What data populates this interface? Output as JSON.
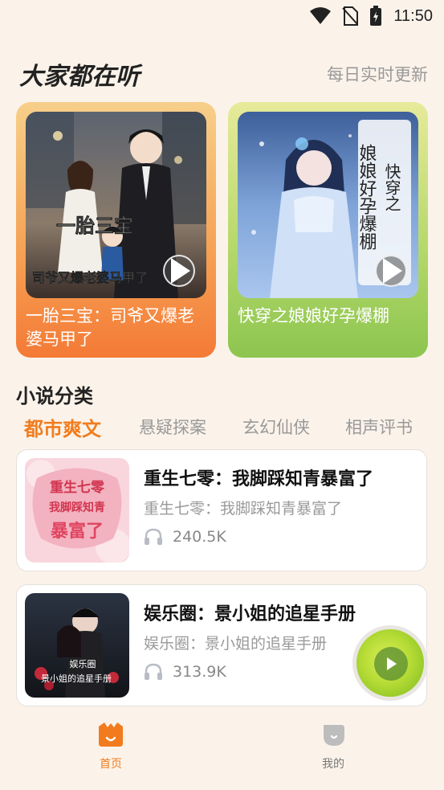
{
  "status_bar": {
    "time": "11:50"
  },
  "popular": {
    "title": "大家都在听",
    "subtitle": "每日实时更新",
    "cards": [
      {
        "title": "一胎三宝：司爷又爆老婆马甲了",
        "cover_text_1": "一胎三宝",
        "cover_text_2": "司爷又爆老婆马甲了",
        "accent": "#f6a053"
      },
      {
        "title": "快穿之娘娘好孕爆棚",
        "cover_text_1": "娘娘好孕爆棚",
        "cover_text_2": "快穿之",
        "accent": "#b7d96c"
      }
    ]
  },
  "categories": {
    "title": "小说分类",
    "tabs": [
      "都市爽文",
      "悬疑探案",
      "玄幻仙侠",
      "相声评书"
    ],
    "active_tab": "都市爽文",
    "active_color": "#f27c1d"
  },
  "books": [
    {
      "title": "重生七零：我脚踩知青暴富了",
      "desc": "重生七零：我脚踩知青暴富了",
      "plays": "240.5K",
      "cover_text_1": "重生七零",
      "cover_text_2": "我脚踩知青",
      "cover_text_3": "暴富了"
    },
    {
      "title": "娱乐圈：景小姐的追星手册",
      "desc": "娱乐圈：景小姐的追星手册",
      "plays": "313.9K",
      "cover_text_1": "娱乐圈",
      "cover_text_2": "景小姐的追星手册"
    }
  ],
  "bottom_nav": {
    "home": "首页",
    "mine": "我的"
  },
  "icons": [
    "wifi-icon",
    "no-sim-icon",
    "battery-icon",
    "play-icon",
    "headphones-icon",
    "home-icon",
    "mine-icon"
  ]
}
